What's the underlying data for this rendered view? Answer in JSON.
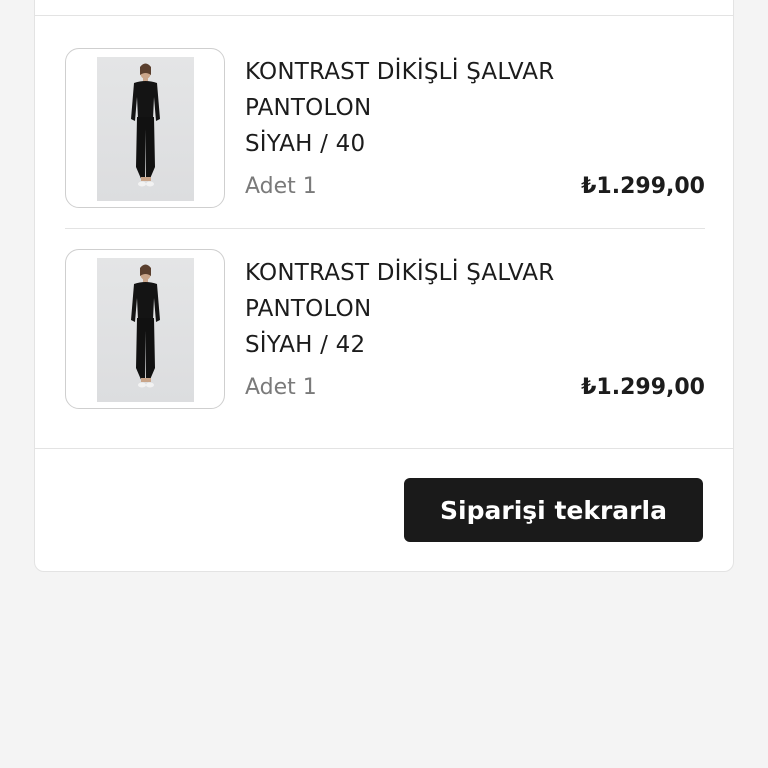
{
  "order": {
    "items": [
      {
        "name_line1": "KONTRAST DİKİŞLİ ŞALVAR",
        "name_line2": "PANTOLON",
        "variant": "SİYAH / 40",
        "quantity": "Adet 1",
        "price": "₺1.299,00",
        "image_alt": "model-wearing-black-salvar-pants"
      },
      {
        "name_line1": "KONTRAST DİKİŞLİ ŞALVAR",
        "name_line2": "PANTOLON",
        "variant": "SİYAH / 42",
        "quantity": "Adet 1",
        "price": "₺1.299,00",
        "image_alt": "model-wearing-black-salvar-pants"
      }
    ],
    "reorder_button_label": "Siparişi tekrarla"
  },
  "colors": {
    "page_background": "#f4f4f4",
    "card_background": "#ffffff",
    "button_background": "#1a1a1a",
    "button_text": "#ffffff",
    "muted_text": "#7a7a7a"
  }
}
